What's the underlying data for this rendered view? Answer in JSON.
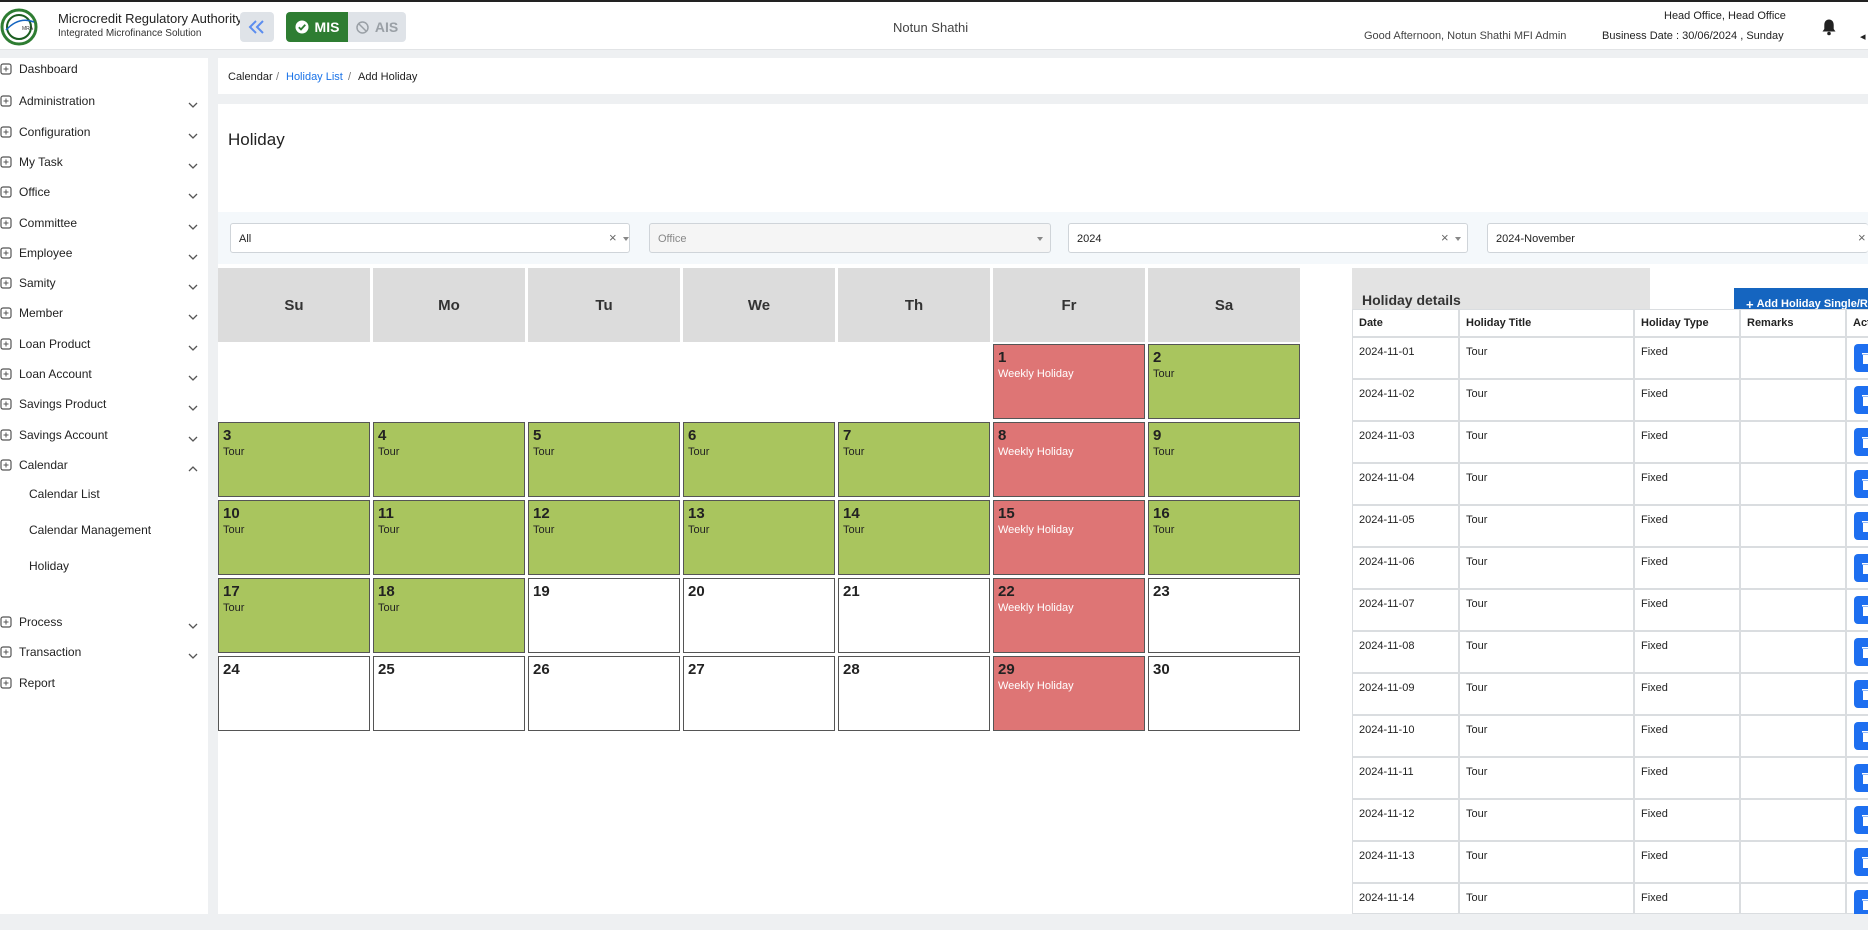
{
  "header": {
    "org_title": "Microcredit Regulatory Authority",
    "org_subtitle": "Integrated Microfinance Solution",
    "logo_text": "Microcredit Regulatory Authority",
    "mis_label": "MIS",
    "ais_label": "AIS",
    "company": "Notun Shathi",
    "greeting": "Good Afternoon, Notun Shathi MFI Admin",
    "office": "Head Office, Head Office",
    "business_date": "Business Date : 30/06/2024 , Sunday",
    "edge_glyph": "◂"
  },
  "sidebar": {
    "items": [
      {
        "label": "Dashboard",
        "icon": "dashboard-icon",
        "chevron": false
      },
      {
        "label": "Administration",
        "icon": "administration-icon",
        "chevron": true
      },
      {
        "label": "Configuration",
        "icon": "configuration-icon",
        "chevron": true
      },
      {
        "label": "My Task",
        "icon": "task-icon",
        "chevron": true
      },
      {
        "label": "Office",
        "icon": "office-icon",
        "chevron": true
      },
      {
        "label": "Committee",
        "icon": "committee-icon",
        "chevron": true
      },
      {
        "label": "Employee",
        "icon": "employee-icon",
        "chevron": true
      },
      {
        "label": "Samity",
        "icon": "samity-icon",
        "chevron": true
      },
      {
        "label": "Member",
        "icon": "member-icon",
        "chevron": true
      },
      {
        "label": "Loan Product",
        "icon": "loan-product-icon",
        "chevron": true
      },
      {
        "label": "Loan Account",
        "icon": "loan-account-icon",
        "chevron": true
      },
      {
        "label": "Savings Product",
        "icon": "savings-product-icon",
        "chevron": true
      },
      {
        "label": "Savings Account",
        "icon": "savings-account-icon",
        "chevron": true
      },
      {
        "label": "Calendar",
        "icon": "calendar-icon",
        "chevron": true,
        "expanded": true
      },
      {
        "label": "Process",
        "icon": "process-icon",
        "chevron": true
      },
      {
        "label": "Transaction",
        "icon": "transaction-icon",
        "chevron": true
      },
      {
        "label": "Report",
        "icon": "report-icon",
        "chevron": false
      }
    ],
    "calendar_children": [
      "Calendar List",
      "Calendar Management",
      "Holiday"
    ]
  },
  "breadcrumb": {
    "root": "Calendar",
    "sep": "/",
    "link": "Holiday List",
    "current": "Add Holiday"
  },
  "page_title": "Holiday",
  "filters": {
    "type": {
      "value": "All"
    },
    "office": {
      "placeholder": "Office"
    },
    "year": {
      "value": "2024"
    },
    "month": {
      "value": "2024-November"
    }
  },
  "calendar": {
    "weekdays": [
      "Su",
      "Mo",
      "Tu",
      "We",
      "Th",
      "Fr",
      "Sa"
    ],
    "first_weekday_index": 5,
    "days": [
      {
        "day": "1",
        "label": "Weekly Holiday",
        "kind": "red"
      },
      {
        "day": "2",
        "label": "Tour",
        "kind": "green"
      },
      {
        "day": "3",
        "label": "Tour",
        "kind": "green"
      },
      {
        "day": "4",
        "label": "Tour",
        "kind": "green"
      },
      {
        "day": "5",
        "label": "Tour",
        "kind": "green"
      },
      {
        "day": "6",
        "label": "Tour",
        "kind": "green"
      },
      {
        "day": "7",
        "label": "Tour",
        "kind": "green"
      },
      {
        "day": "8",
        "label": "Weekly Holiday",
        "kind": "red"
      },
      {
        "day": "9",
        "label": "Tour",
        "kind": "green"
      },
      {
        "day": "10",
        "label": "Tour",
        "kind": "green"
      },
      {
        "day": "11",
        "label": "Tour",
        "kind": "green"
      },
      {
        "day": "12",
        "label": "Tour",
        "kind": "green"
      },
      {
        "day": "13",
        "label": "Tour",
        "kind": "green"
      },
      {
        "day": "14",
        "label": "Tour",
        "kind": "green"
      },
      {
        "day": "15",
        "label": "Weekly Holiday",
        "kind": "red"
      },
      {
        "day": "16",
        "label": "Tour",
        "kind": "green"
      },
      {
        "day": "17",
        "label": "Tour",
        "kind": "green"
      },
      {
        "day": "18",
        "label": "Tour",
        "kind": "green"
      },
      {
        "day": "19",
        "label": "",
        "kind": "plain"
      },
      {
        "day": "20",
        "label": "",
        "kind": "plain"
      },
      {
        "day": "21",
        "label": "",
        "kind": "plain"
      },
      {
        "day": "22",
        "label": "Weekly Holiday",
        "kind": "red"
      },
      {
        "day": "23",
        "label": "",
        "kind": "plain"
      },
      {
        "day": "24",
        "label": "",
        "kind": "plain"
      },
      {
        "day": "25",
        "label": "",
        "kind": "plain"
      },
      {
        "day": "26",
        "label": "",
        "kind": "plain"
      },
      {
        "day": "27",
        "label": "",
        "kind": "plain"
      },
      {
        "day": "28",
        "label": "",
        "kind": "plain"
      },
      {
        "day": "29",
        "label": "Weekly Holiday",
        "kind": "red"
      },
      {
        "day": "30",
        "label": "",
        "kind": "plain"
      }
    ]
  },
  "holiday_details": {
    "title": "Holiday details",
    "add_button": "Add Holiday Single/Range",
    "columns": [
      "Date",
      "Holiday Title",
      "Holiday Type",
      "Remarks",
      "Action"
    ],
    "rows": [
      {
        "date": "2024-11-01",
        "title": "Tour",
        "type": "Fixed",
        "remarks": ""
      },
      {
        "date": "2024-11-02",
        "title": "Tour",
        "type": "Fixed",
        "remarks": ""
      },
      {
        "date": "2024-11-03",
        "title": "Tour",
        "type": "Fixed",
        "remarks": ""
      },
      {
        "date": "2024-11-04",
        "title": "Tour",
        "type": "Fixed",
        "remarks": ""
      },
      {
        "date": "2024-11-05",
        "title": "Tour",
        "type": "Fixed",
        "remarks": ""
      },
      {
        "date": "2024-11-06",
        "title": "Tour",
        "type": "Fixed",
        "remarks": ""
      },
      {
        "date": "2024-11-07",
        "title": "Tour",
        "type": "Fixed",
        "remarks": ""
      },
      {
        "date": "2024-11-08",
        "title": "Tour",
        "type": "Fixed",
        "remarks": ""
      },
      {
        "date": "2024-11-09",
        "title": "Tour",
        "type": "Fixed",
        "remarks": ""
      },
      {
        "date": "2024-11-10",
        "title": "Tour",
        "type": "Fixed",
        "remarks": ""
      },
      {
        "date": "2024-11-11",
        "title": "Tour",
        "type": "Fixed",
        "remarks": ""
      },
      {
        "date": "2024-11-12",
        "title": "Tour",
        "type": "Fixed",
        "remarks": ""
      },
      {
        "date": "2024-11-13",
        "title": "Tour",
        "type": "Fixed",
        "remarks": ""
      },
      {
        "date": "2024-11-14",
        "title": "Tour",
        "type": "Fixed",
        "remarks": ""
      }
    ]
  },
  "colors": {
    "mis_green": "#2e7d32",
    "holiday_green": "#a9c55e",
    "weekly_red": "#de7575",
    "primary_blue": "#1565c0",
    "link_blue": "#1a73e8"
  }
}
